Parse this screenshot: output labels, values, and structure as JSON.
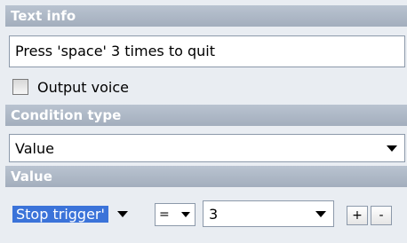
{
  "text_info": {
    "header": "Text info",
    "value": "Press 'space' 3 times to quit",
    "output_voice_label": "Output voice",
    "output_voice_checked": false
  },
  "condition_type": {
    "header": "Condition type",
    "selected": "Value"
  },
  "value_section": {
    "header": "Value",
    "trigger_selected": "Stop trigger'",
    "operator_selected": "=",
    "number_selected": "3",
    "plus_label": "+",
    "minus_label": "-"
  },
  "colors": {
    "header_bg": "#a3aebd",
    "selection_highlight": "#3b73d9",
    "panel_bg": "#e9edf2"
  }
}
